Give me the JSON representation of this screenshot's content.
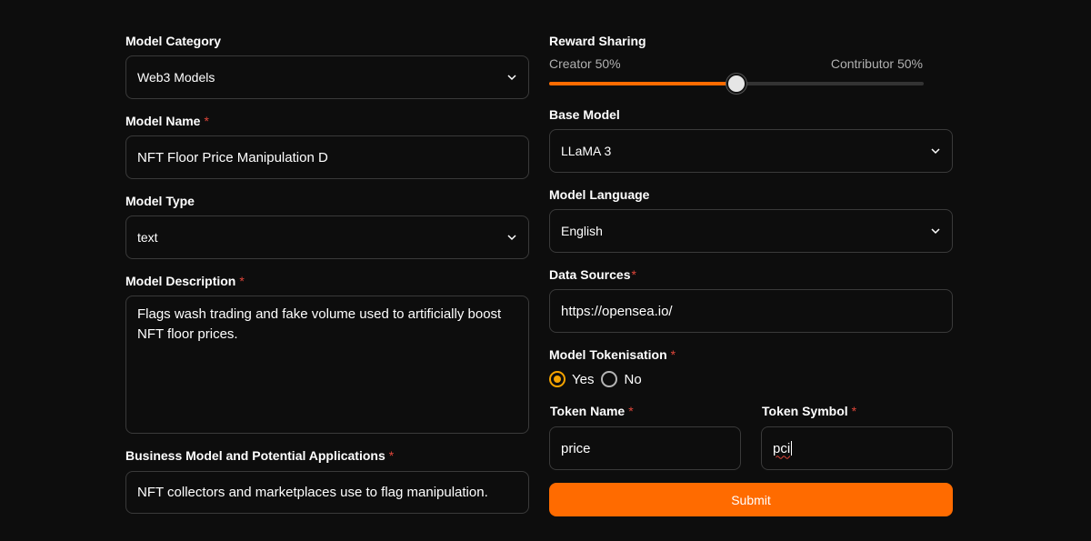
{
  "left": {
    "model_category": {
      "label": "Model Category",
      "value": "Web3 Models"
    },
    "model_name": {
      "label": "Model Name",
      "required_mark": "*",
      "value": "NFT Floor Price Manipulation D"
    },
    "model_type": {
      "label": "Model Type",
      "value": "text"
    },
    "model_description": {
      "label": "Model Description",
      "required_mark": "*",
      "value": "Flags wash trading and fake volume used to artificially boost NFT floor prices."
    },
    "business_model": {
      "label": "Business Model and Potential Applications",
      "required_mark": "*",
      "value": "NFT collectors and marketplaces use to flag manipulation."
    }
  },
  "right": {
    "reward_sharing": {
      "label": "Reward Sharing",
      "creator_caption": "Creator 50%",
      "contributor_caption": "Contributor 50%",
      "creator_share_percent": 50
    },
    "base_model": {
      "label": "Base Model",
      "value": "LLaMA 3"
    },
    "model_language": {
      "label": "Model Language",
      "value": "English"
    },
    "data_sources": {
      "label": "Data Sources",
      "required_mark": "*",
      "value": "https://opensea.io/"
    },
    "model_tokenisation": {
      "label": "Model Tokenisation",
      "required_mark": "*",
      "options": [
        {
          "label": "Yes",
          "checked": true
        },
        {
          "label": "No",
          "checked": false
        }
      ]
    },
    "token_name": {
      "label": "Token Name",
      "required_mark": "*",
      "value": "price"
    },
    "token_symbol": {
      "label": "Token Symbol",
      "required_mark": "*",
      "value": "pci"
    },
    "submit_label": "Submit"
  },
  "icons": {
    "select_chevron": "chevron-down-icon"
  },
  "colors": {
    "accent": "#ff6b00",
    "radio_checked": "#f5a300",
    "required": "#e0463a",
    "background": "#0d0d0d",
    "border": "#3a3a3a"
  }
}
